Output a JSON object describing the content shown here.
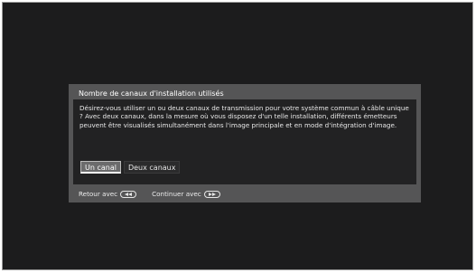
{
  "dialog": {
    "title": "Nombre de canaux d'installation utilisés",
    "message": "Désirez-vous utiliser un ou deux canaux de transmission pour votre système commun à câble unique ? Avec deux canaux, dans la mesure où vous disposez d'un telle installation, différents émetteurs peuvent être visualisés simultanément dans l'image principale et en mode d'intégration d'image.",
    "options": [
      {
        "label": "Un canal",
        "selected": true
      },
      {
        "label": "Deux canaux",
        "selected": false
      }
    ]
  },
  "footer": {
    "back_label": "Retour avec",
    "back_icon": "rewind-button-icon",
    "continue_label": "Continuer avec",
    "continue_icon": "fast-forward-button-icon"
  },
  "colors": {
    "screen_bg": "#1c1c1d",
    "dialog_bg": "#555556",
    "content_bg": "#222223",
    "selected_option_bg": "#6b6b6c"
  }
}
